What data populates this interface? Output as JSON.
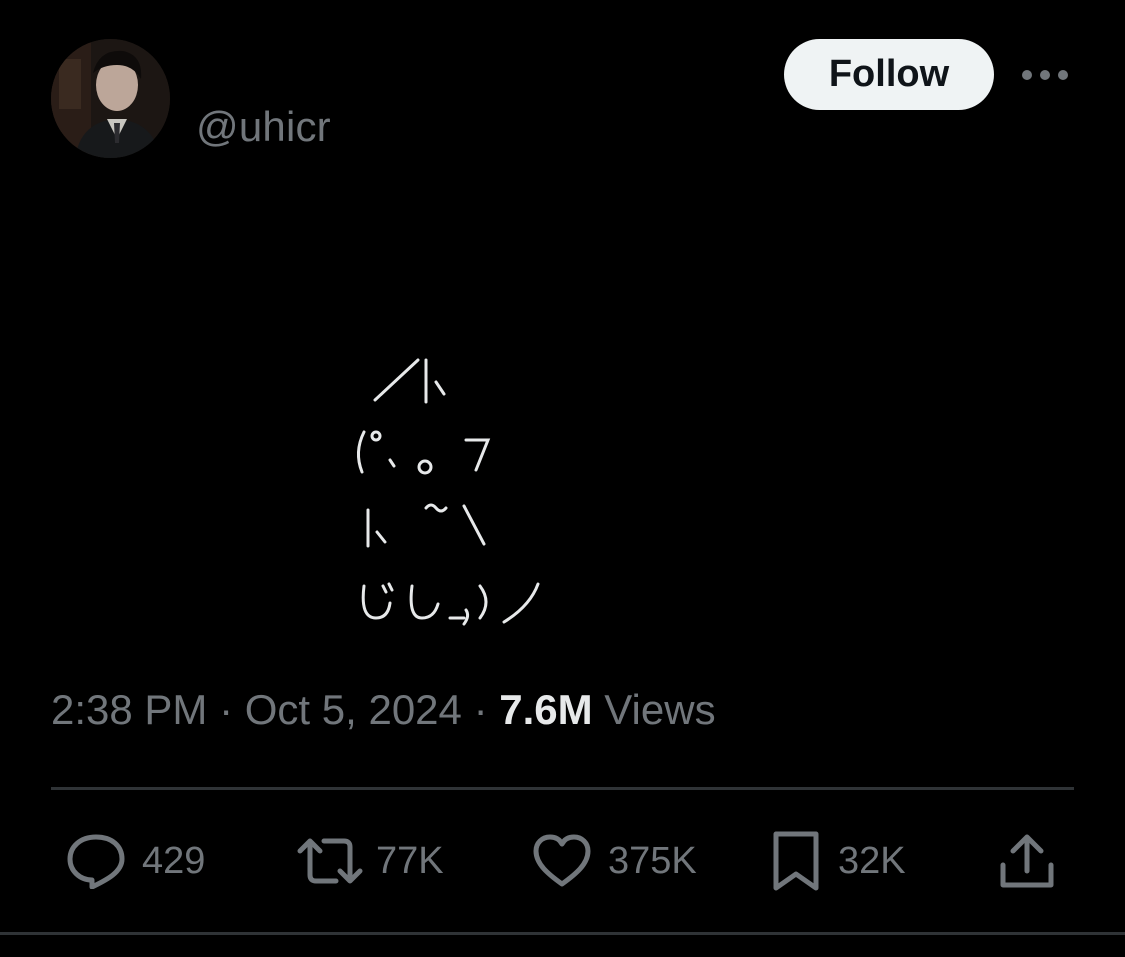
{
  "tweet": {
    "handle": "@uhicr",
    "follow_label": "Follow",
    "ascii_art": [
      "／|、",
      "(ﾟ､ 。 7",
      "|、 ~ヽ",
      "じしf_,)ノ"
    ],
    "time": "2:38 PM",
    "date": "Oct 5, 2024",
    "separator": "·",
    "views_count": "7.6M",
    "views_label": "Views"
  },
  "actions": {
    "replies": "429",
    "reposts": "77K",
    "likes": "375K",
    "bookmarks": "32K"
  },
  "icons": {
    "avatar": "profile-photo",
    "more": "more-horizontal-icon",
    "reply": "reply-icon",
    "repost": "repost-icon",
    "like": "heart-icon",
    "bookmark": "bookmark-icon",
    "share": "share-icon"
  },
  "colors": {
    "background": "#000000",
    "text_primary": "#e7e9ea",
    "text_secondary": "#71767b",
    "divider": "#2f3336",
    "follow_bg": "#eff3f4",
    "follow_text": "#0f1419"
  }
}
